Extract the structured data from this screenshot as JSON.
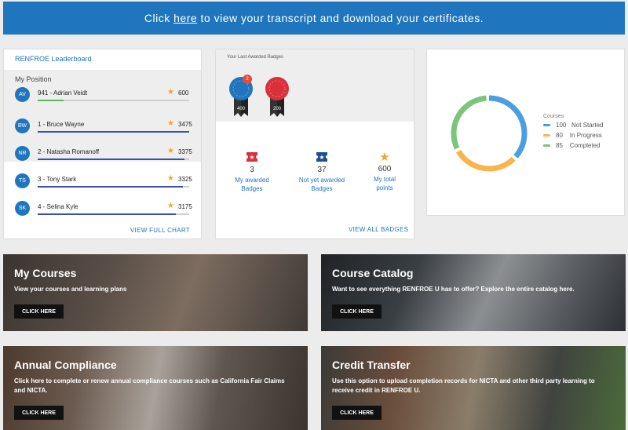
{
  "banner": {
    "pre": "Click ",
    "link": "here",
    "post": " to view your transcript and download your certificates."
  },
  "leaderboard": {
    "title": "RENFROE Leaderboard",
    "my_position_label": "My Position",
    "me": {
      "initials": "AV",
      "name": "941 - Adrian Veidt",
      "points": "600",
      "progress": 0.17,
      "bar_color": "#5cb85c"
    },
    "rows": [
      {
        "initials": "BW",
        "name": "1 - Bruce Wayne",
        "points": "3475",
        "progress": 1.0,
        "bar_color": "#3d4fa8"
      },
      {
        "initials": "NR",
        "name": "2 - Natasha Romanoff",
        "points": "3375",
        "progress": 0.97,
        "bar_color": "#3d4fa8"
      },
      {
        "initials": "TS",
        "name": "3 - Tony Stark",
        "points": "3325",
        "progress": 0.96,
        "bar_color": "#3d4fa8"
      },
      {
        "initials": "SK",
        "name": "4 - Selina Kyle",
        "points": "3175",
        "progress": 0.91,
        "bar_color": "#3d4fa8"
      }
    ],
    "footer_link": "VIEW FULL CHART"
  },
  "badges": {
    "title": "Your Last Awarded Badges",
    "last": [
      {
        "label": "400",
        "color": "#1f75be",
        "count": "2"
      },
      {
        "label": "200",
        "color": "#d9303a"
      }
    ],
    "stats": [
      {
        "icon": "ticket-star-icon",
        "icon_color": "#d9303a",
        "value": "3",
        "label1": "My awarded",
        "label2": "Badges"
      },
      {
        "icon": "ticket-star-icon",
        "icon_color": "#1f4f8f",
        "value": "37",
        "label1": "Not yet awarded",
        "label2": "Badges"
      },
      {
        "icon": "star-icon",
        "icon_color": "#f2a628",
        "value": "600",
        "label1": "My total",
        "label2": "points"
      }
    ],
    "footer_link": "VIEW ALL BADGES"
  },
  "courses": {
    "legend_title": "Courses",
    "items": [
      {
        "value": "100",
        "label": "Not Started",
        "color": "#4a9fe0"
      },
      {
        "value": "80",
        "label": "In Progress",
        "color": "#f9b54c"
      },
      {
        "value": "85",
        "label": "Completed",
        "color": "#7cc47a"
      }
    ]
  },
  "tiles": [
    {
      "title": "My Courses",
      "desc": "View your courses and learning plans",
      "button": "CLICK HERE"
    },
    {
      "title": "Course Catalog",
      "desc": "Want to see everything RENFROE U has to offer? Explore the entire catalog here.",
      "button": "CLICK HERE"
    },
    {
      "title": "Annual Compliance",
      "desc": "Click here to complete or renew annual compliance courses such as California Fair Claims and NICTA.",
      "button": "CLICK HERE"
    },
    {
      "title": "Credit Transfer",
      "desc": "Use this option to upload completion records for NICTA and other third party learning to receive credit in RENFROE U.",
      "button": "CLICK HERE"
    }
  ]
}
